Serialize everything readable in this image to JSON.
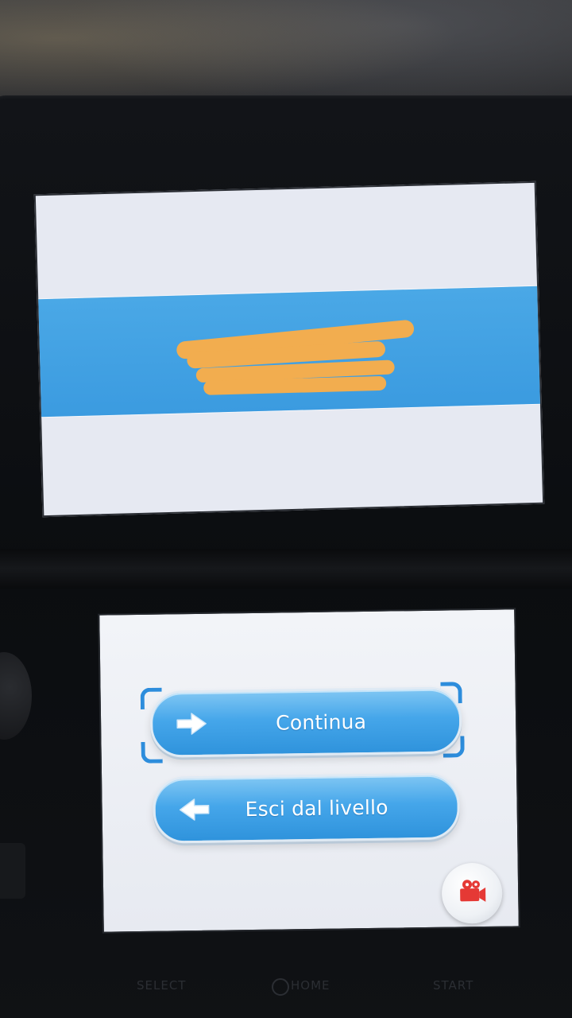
{
  "top_screen": {
    "band_text_redacted": true
  },
  "bottom_screen": {
    "continue_button": {
      "label": "Continua",
      "icon": "arrow-right-icon",
      "selected": true
    },
    "exit_button": {
      "label": "Esci dal livello",
      "icon": "arrow-left-icon"
    },
    "camera_button": {
      "icon": "movie-camera-icon"
    }
  },
  "console": {
    "select_label": "SELECT",
    "home_label": "HOME",
    "start_label": "START"
  },
  "colors": {
    "button_blue": "#45a6ea",
    "band_blue": "#3b9be0",
    "redaction": "#f2ad4f",
    "camera_red": "#e53935",
    "selection_corner": "#2d8ddc"
  }
}
